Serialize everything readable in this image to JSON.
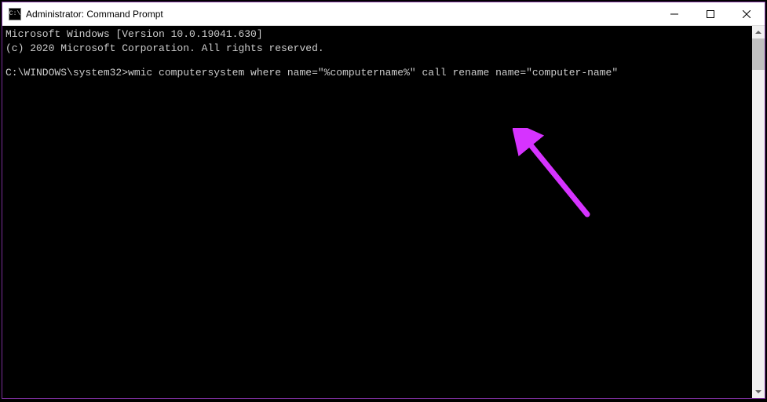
{
  "titlebar": {
    "icon_text": "C:\\",
    "title": "Administrator: Command Prompt"
  },
  "terminal": {
    "line1": "Microsoft Windows [Version 10.0.19041.630]",
    "line2": "(c) 2020 Microsoft Corporation. All rights reserved.",
    "prompt": "C:\\WINDOWS\\system32>",
    "command": "wmic computersystem where name=\"%computername%\" call rename name=\"computer-name\""
  },
  "annotation": {
    "arrow_color": "#d633ff"
  }
}
